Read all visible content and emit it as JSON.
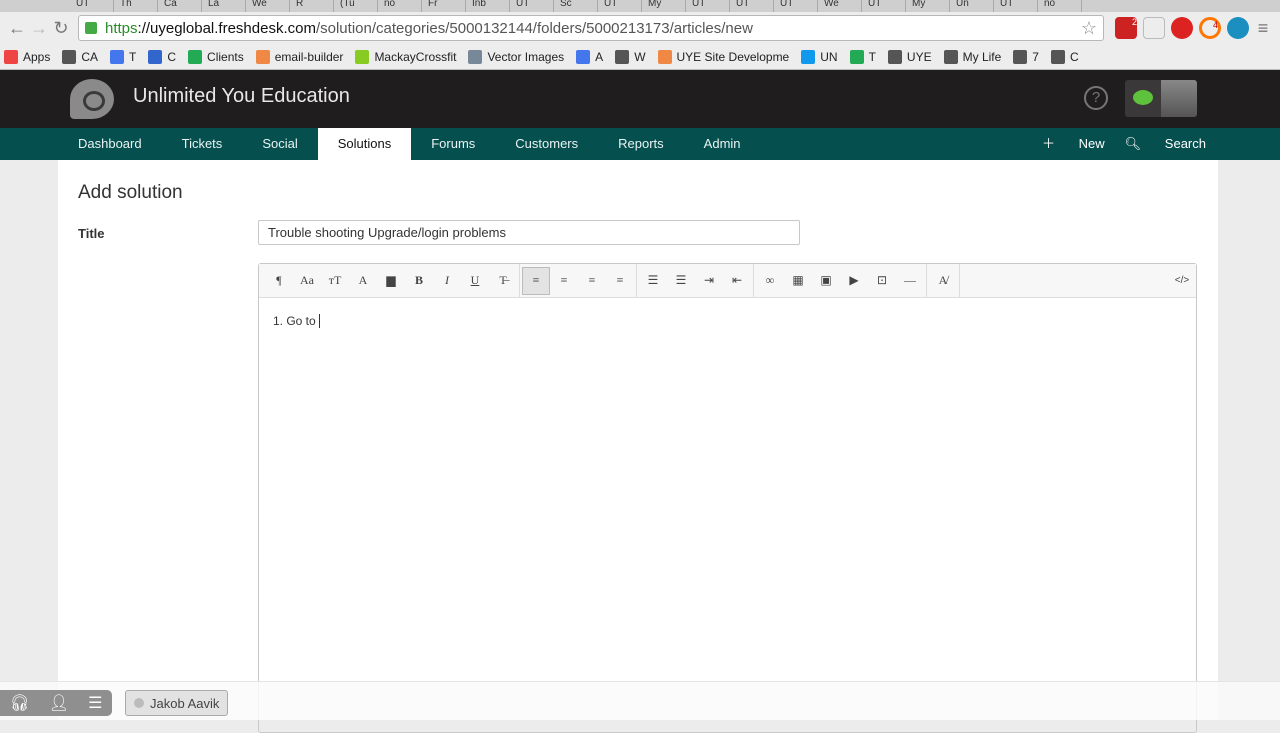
{
  "browser": {
    "tabs": [
      "UT",
      "Th",
      "Ca",
      "La",
      "We",
      "R",
      "(Tu",
      "no",
      "Fr",
      "Inb",
      "UT",
      "Sc",
      "UT",
      "My",
      "UT",
      "UT",
      "UT",
      "We",
      "UT",
      "My",
      "Un",
      "UT",
      "no"
    ],
    "url_scheme": "https",
    "url_host": "://uyeglobal.freshdesk.com",
    "url_path": "/solution/categories/5000132144/folders/5000213173/articles/new",
    "bookmarks": [
      "Apps",
      "CA",
      "T",
      "C",
      "Clients",
      "email-builder",
      "MackayCrossfit",
      "Vector Images",
      "A",
      "W",
      "UYE Site Developme",
      "UN",
      "T",
      "UYE",
      "My Life",
      "7",
      "C"
    ],
    "ext_badges": [
      "2",
      "4"
    ]
  },
  "header": {
    "brand": "Unlimited You Education",
    "help": "?"
  },
  "nav": {
    "items": [
      "Dashboard",
      "Tickets",
      "Social",
      "Solutions",
      "Forums",
      "Customers",
      "Reports",
      "Admin"
    ],
    "active": "Solutions",
    "new_label": "New",
    "search_label": "Search"
  },
  "form": {
    "page_title": "Add solution",
    "title_label": "Title",
    "title_value": "Trouble shooting Upgrade/login problems",
    "body_text": "1. Go to "
  },
  "toolbar": {
    "code_label": "</>"
  },
  "footer": {
    "user": "Jakob Aavik"
  }
}
